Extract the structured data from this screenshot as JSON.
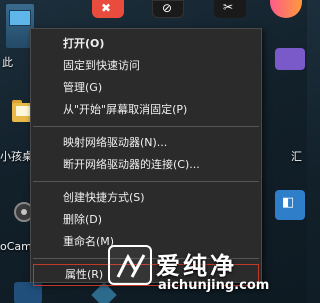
{
  "desktop": {
    "icons": [
      {
        "name": "this-pc",
        "label": "此"
      },
      {
        "name": "folder",
        "label": "小孩桌"
      },
      {
        "name": "ocam",
        "label": "oCam"
      },
      {
        "name": "right-label",
        "label": "汇"
      }
    ]
  },
  "context_menu": {
    "items": [
      {
        "label": "打开(O)"
      },
      {
        "label": "固定到快速访问"
      },
      {
        "label": "管理(G)"
      },
      {
        "label": "从\"开始\"屏幕取消固定(P)"
      },
      {
        "label": "映射网络驱动器(N)..."
      },
      {
        "label": "断开网络驱动器的连接(C)..."
      },
      {
        "label": "创建快捷方式(S)"
      },
      {
        "label": "删除(D)"
      },
      {
        "label": "重命名(M)"
      },
      {
        "label": "属性(R)"
      }
    ]
  },
  "watermark": {
    "title": "爱纯净",
    "url": "aichunjing.com"
  }
}
